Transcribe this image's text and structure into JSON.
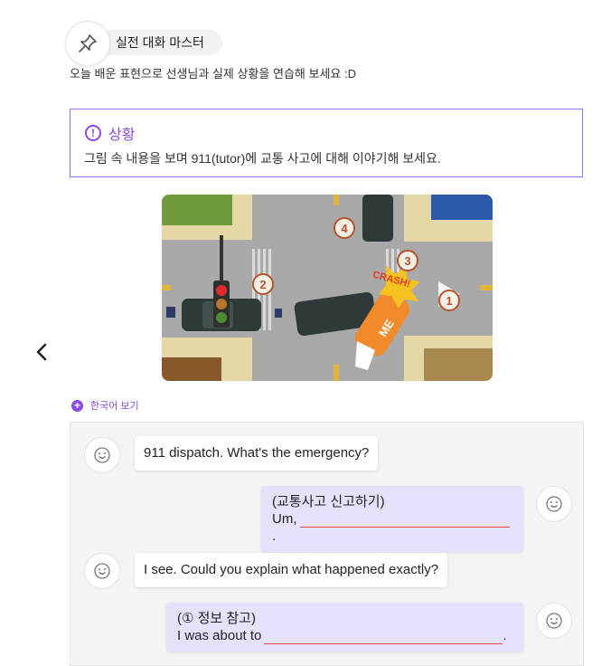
{
  "header": {
    "title": "실전 대화 마스터",
    "subtitle": "오늘 배운 표현으로 선생님과 실제 상황을 연습해 보세요 :D",
    "pin_icon": "pin-icon"
  },
  "situation": {
    "heading": "상황",
    "text": "그림 속 내용을 보며 911(tutor)에 교통 사고에 대해 이야기해 보세요.",
    "accent_color": "#8a4be0"
  },
  "scene_image": {
    "labels": [
      "①",
      "②",
      "③",
      "④"
    ],
    "crash_text": "CRASH!",
    "me_text": "ME"
  },
  "nav": {
    "back_icon": "chevron-left-icon"
  },
  "korean_toggle": {
    "label": "한국어 보기"
  },
  "chat": {
    "messages": [
      {
        "role": "tutor",
        "text": "911 dispatch. What's the emergency?"
      },
      {
        "role": "me",
        "hint": "(교통사고 신고하기)",
        "prefix": "Um,",
        "suffix": "."
      },
      {
        "role": "tutor",
        "text": "I see. Could you explain what happened exactly?"
      },
      {
        "role": "me",
        "hint": "(① 정보 참고)",
        "prefix": "I was about to",
        "suffix": "."
      }
    ]
  }
}
